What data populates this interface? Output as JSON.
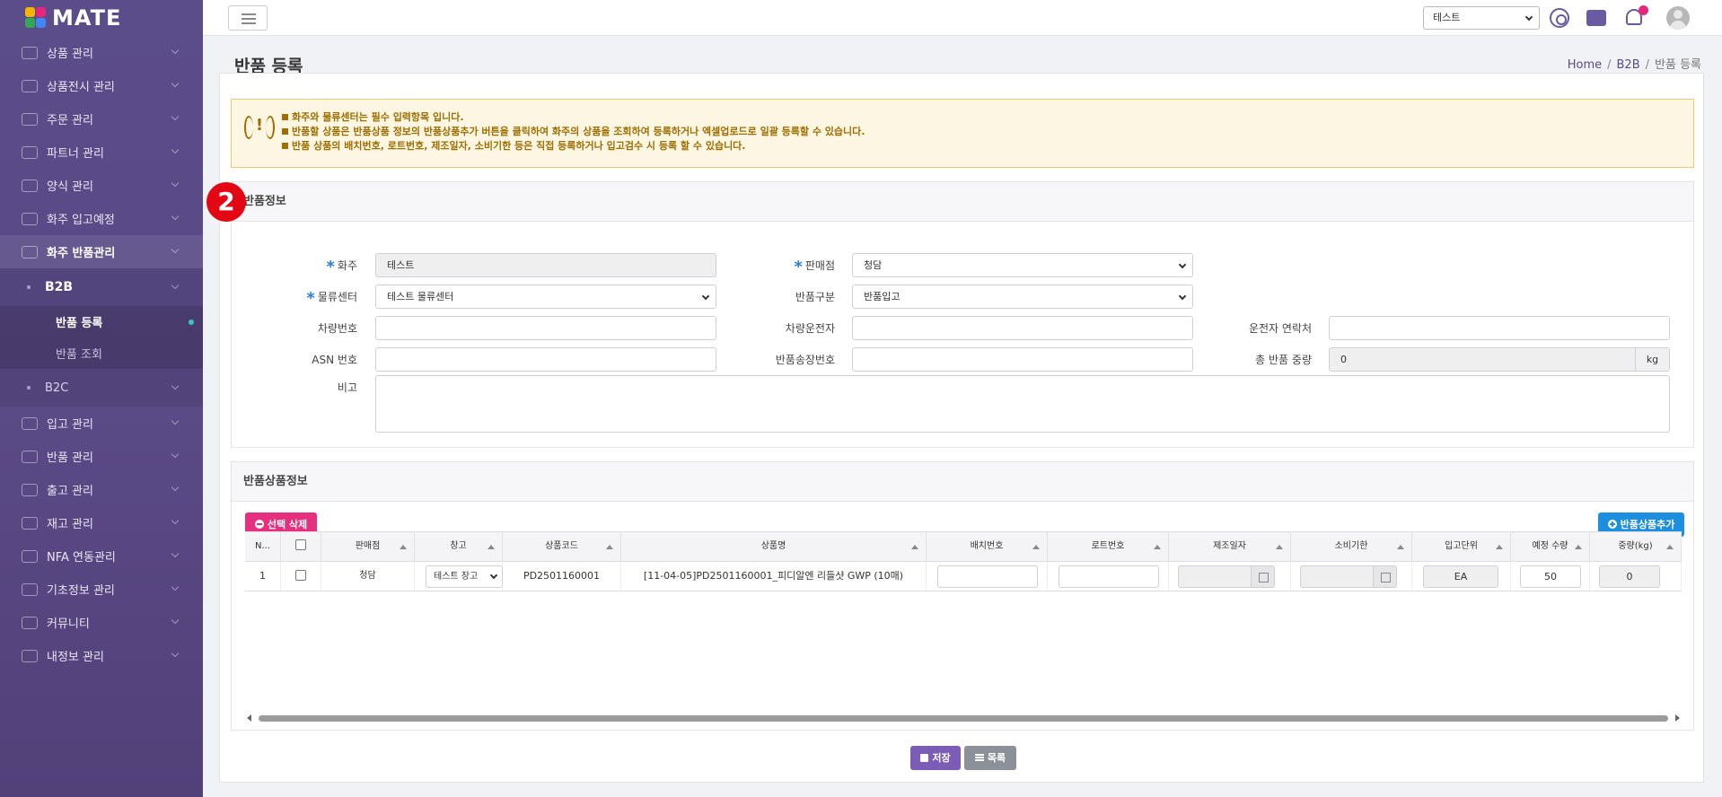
{
  "app": {
    "name": "MATE"
  },
  "sidebar": {
    "items": [
      {
        "label": "상품 관리",
        "icon": "package-icon"
      },
      {
        "label": "상품전시 관리",
        "icon": "store-icon"
      },
      {
        "label": "주문 관리",
        "icon": "cart-icon"
      },
      {
        "label": "파트너 관리",
        "icon": "handshake-icon"
      },
      {
        "label": "양식 관리",
        "icon": "document-icon"
      },
      {
        "label": "화주 입고예정",
        "icon": "truck-in-icon"
      },
      {
        "label": "화주 반품관리",
        "icon": "return-icon"
      }
    ],
    "sub": {
      "b2b": "B2B",
      "b2b_items": [
        "반품 등록",
        "반품 조회"
      ],
      "b2c": "B2C"
    },
    "items2": [
      {
        "label": "입고 관리",
        "icon": "inbound-icon"
      },
      {
        "label": "반품 관리",
        "icon": "return-box-icon"
      },
      {
        "label": "출고 관리",
        "icon": "delivery-truck-icon"
      },
      {
        "label": "재고 관리",
        "icon": "inventory-icon"
      },
      {
        "label": "NFA 연동관리",
        "icon": "link-icon"
      },
      {
        "label": "기초정보 관리",
        "icon": "wrench-icon"
      },
      {
        "label": "커뮤니티",
        "icon": "chat-icon"
      },
      {
        "label": "내정보 관리",
        "icon": "info-icon"
      }
    ]
  },
  "topbar": {
    "selector_value": "테스트"
  },
  "page": {
    "title": "반품 등록",
    "breadcrumb": [
      "Home",
      "B2B",
      "반품 등록"
    ]
  },
  "notice": {
    "lines": [
      "화주와 물류센터는 필수 입력항목 입니다.",
      "반품할 상품은 반품상품 정보의 반품상품추가 버튼을 클릭하여 화주의 상품을 조회하여 등록하거나 엑셀업로드로 일괄 등록할 수 있습니다.",
      "반품 상품의 배치번호, 로트번호, 제조일자, 소비기한 등은 직접 등록하거나 입고검수 시 등록 할 수 있습니다."
    ]
  },
  "return_info": {
    "section_title": "반품정보",
    "step_badge": "2",
    "shipper_label": "화주",
    "shipper_value": "테스트",
    "seller_label": "판매점",
    "seller_value": "청담",
    "center_label": "물류센터",
    "center_value": "테스트 물류센터",
    "type_label": "반품구분",
    "type_value": "반품입고",
    "vehicle_label": "차량번호",
    "vehicle_value": "",
    "driver_label": "차량운전자",
    "driver_value": "",
    "driver_phone_label": "운전자 연락처",
    "driver_phone_value": "",
    "asn_label": "ASN 번호",
    "asn_value": "",
    "invoice_label": "반품송장번호",
    "invoice_value": "",
    "weight_label": "총 반품 중량",
    "weight_value": "0",
    "weight_unit": "kg",
    "memo_label": "비고"
  },
  "products": {
    "section_title": "반품상품정보",
    "delete_button": "선택 삭제",
    "add_button": "반품상품추가",
    "columns": [
      "N...",
      "",
      "판매점",
      "창고",
      "상품코드",
      "상품명",
      "배치번호",
      "로트번호",
      "제조일자",
      "소비기한",
      "입고단위",
      "예정 수량",
      "중량(kg)"
    ],
    "rows": [
      {
        "no": "1",
        "seller": "청담",
        "warehouse": "테스트 창고",
        "code": "PD2501160001",
        "name": "[11-04-05]PD2501160001_피디알엔 리들샷 GWP (10매)",
        "batch": "",
        "lot": "",
        "mfg": "",
        "exp": "",
        "unit": "EA",
        "qty": "50",
        "weight": "0"
      }
    ]
  },
  "footer": {
    "save_button": "저장",
    "list_button": "목록"
  },
  "colors": {
    "sidebar": "#5a4a86",
    "accent": "#6a5aa3",
    "delete": "#e6307f",
    "add": "#1d8fe0",
    "badge": "#e30613"
  }
}
